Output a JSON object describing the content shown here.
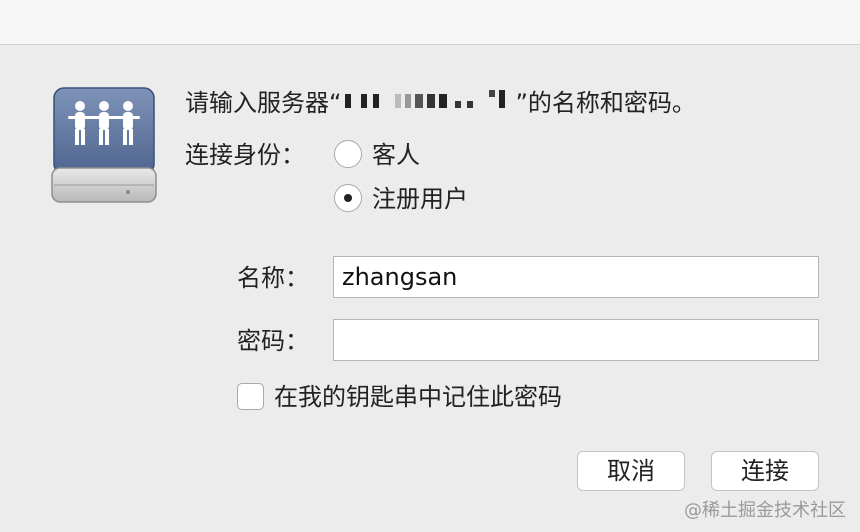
{
  "dialog": {
    "prompt_prefix": "请输入服务器“",
    "prompt_suffix": "”的名称和密码。",
    "connect_as_label": "连接身份：",
    "options": [
      {
        "label": "客人",
        "selected": false
      },
      {
        "label": "注册用户",
        "selected": true
      }
    ],
    "name_label": "名称：",
    "name_value": "zhangsan",
    "password_label": "密码：",
    "password_value": "",
    "remember_label": "在我的钥匙串中记住此密码",
    "remember_checked": false,
    "cancel_label": "取消",
    "connect_label": "连接"
  },
  "watermark": "@稀土掘金技术社区",
  "icons": [
    "server-users-icon"
  ]
}
